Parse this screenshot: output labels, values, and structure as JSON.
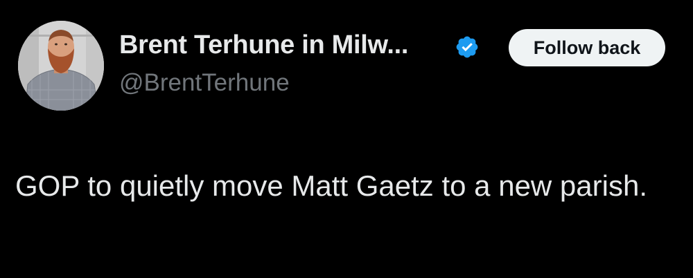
{
  "colors": {
    "background": "#000000",
    "primary_text": "#e7e9ea",
    "secondary_text": "#71767b",
    "verified_blue": "#1d9bf0",
    "button_bg": "#eff3f4",
    "button_text": "#0f1419"
  },
  "author": {
    "display_name": "Brent Terhune in Milw...",
    "handle": "@BrentTerhune",
    "verified_icon": "verified-badge-icon",
    "avatar_icon": "profile-photo"
  },
  "actions": {
    "follow_label": "Follow back"
  },
  "tweet": {
    "text": "GOP to quietly move Matt Gaetz to a new parish."
  }
}
